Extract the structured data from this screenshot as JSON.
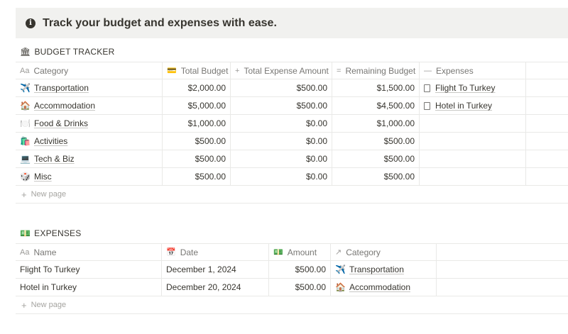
{
  "callout": {
    "text": "Track your budget and expenses with ease.",
    "icon": "info-icon"
  },
  "budget": {
    "title": "BUDGET TRACKER",
    "title_icon": "🏛",
    "headers": [
      {
        "icon": "Aa",
        "label": "Category"
      },
      {
        "icon": "💳",
        "label": "Total Budget"
      },
      {
        "icon": "+",
        "label": "Total Expense Amount"
      },
      {
        "icon": "=",
        "label": "Remaining Budget"
      },
      {
        "icon": "—",
        "label": "Expenses"
      }
    ],
    "rows": [
      {
        "emoji": "✈️",
        "category": "Transportation",
        "total_budget": "$2,000.00",
        "total_expense": "$500.00",
        "remaining": "$1,500.00",
        "expenses": "Flight To Turkey"
      },
      {
        "emoji": "🏠",
        "category": "Accommodation",
        "total_budget": "$5,000.00",
        "total_expense": "$500.00",
        "remaining": "$4,500.00",
        "expenses": "Hotel in Turkey"
      },
      {
        "emoji": "🍽️",
        "category": "Food & Drinks",
        "total_budget": "$1,000.00",
        "total_expense": "$0.00",
        "remaining": "$1,000.00",
        "expenses": ""
      },
      {
        "emoji": "🛍️",
        "category": "Activities",
        "total_budget": "$500.00",
        "total_expense": "$0.00",
        "remaining": "$500.00",
        "expenses": ""
      },
      {
        "emoji": "💻",
        "category": "Tech & Biz",
        "total_budget": "$500.00",
        "total_expense": "$0.00",
        "remaining": "$500.00",
        "expenses": ""
      },
      {
        "emoji": "🎲",
        "category": "Misc",
        "total_budget": "$500.00",
        "total_expense": "$0.00",
        "remaining": "$500.00",
        "expenses": ""
      }
    ],
    "new_page": "New page"
  },
  "expenses": {
    "title": "EXPENSES",
    "title_icon": "💵",
    "headers": [
      {
        "icon": "Aa",
        "label": "Name"
      },
      {
        "icon": "📅",
        "label": "Date"
      },
      {
        "icon": "💵",
        "label": "Amount"
      },
      {
        "icon": "↗",
        "label": "Category"
      }
    ],
    "rows": [
      {
        "name": "Flight To Turkey",
        "date": "December 1, 2024",
        "amount": "$500.00",
        "category_emoji": "✈️",
        "category": "Transportation"
      },
      {
        "name": "Hotel in Turkey",
        "date": "December 20, 2024",
        "amount": "$500.00",
        "category_emoji": "🏠",
        "category": "Accommodation"
      }
    ],
    "new_page": "New page"
  }
}
